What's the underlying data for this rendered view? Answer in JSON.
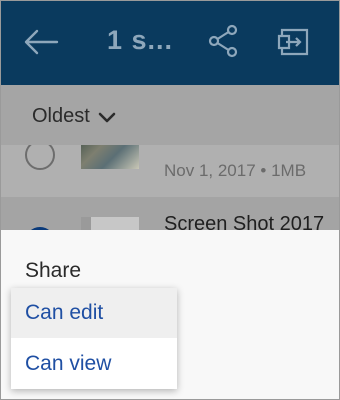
{
  "header": {
    "title": "1 s...",
    "icons": [
      "back-arrow-icon",
      "share-icon",
      "move-to-folder-icon"
    ]
  },
  "sort": {
    "label": "Oldest"
  },
  "files": [
    {
      "meta": "Nov 1, 2017 • 1MB",
      "selected": false
    },
    {
      "name": "Screen Shot 2017",
      "selected": true
    }
  ],
  "sheet": {
    "title": "Share",
    "options": [
      "Can edit",
      "Can view"
    ]
  },
  "colors": {
    "appbar": "#0a3a5e",
    "link": "#1f4fa3"
  }
}
